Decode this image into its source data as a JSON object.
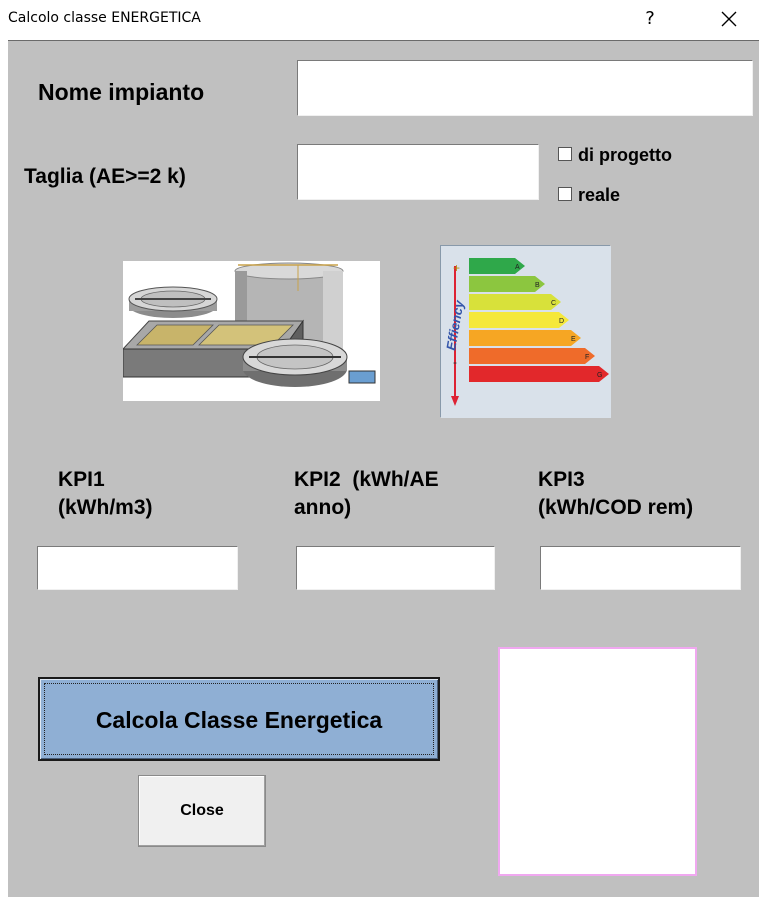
{
  "window": {
    "title": "Calcolo classe ENERGETICA",
    "help_label": "?"
  },
  "form": {
    "nome_label": "Nome impianto",
    "nome_value": "",
    "taglia_label": "Taglia (AE>=2 k)",
    "taglia_value": "",
    "check_progetto_label": "di progetto",
    "check_reale_label": "reale",
    "kpi1_label_line1": "KPI1",
    "kpi1_label_line2": "(kWh/m3)",
    "kpi2_label_line1": "KPI2  (kWh/AE",
    "kpi2_label_line2": "anno)",
    "kpi3_label_line1": "KPI3",
    "kpi3_label_line2": "(kWh/COD rem)",
    "kpi1_value": "",
    "kpi2_value": "",
    "kpi3_value": ""
  },
  "energy_label": {
    "side_text": "Effiency",
    "plus": "+",
    "minus": "-",
    "classes": [
      "A",
      "B",
      "C",
      "D",
      "E",
      "F",
      "G"
    ],
    "colors": [
      "#2fa84a",
      "#8cc63f",
      "#d8e13a",
      "#f5e83a",
      "#f6a623",
      "#ef6b2a",
      "#e2282b"
    ]
  },
  "buttons": {
    "calcola_label": "Calcola Classe Energetica",
    "close_label": "Close"
  }
}
